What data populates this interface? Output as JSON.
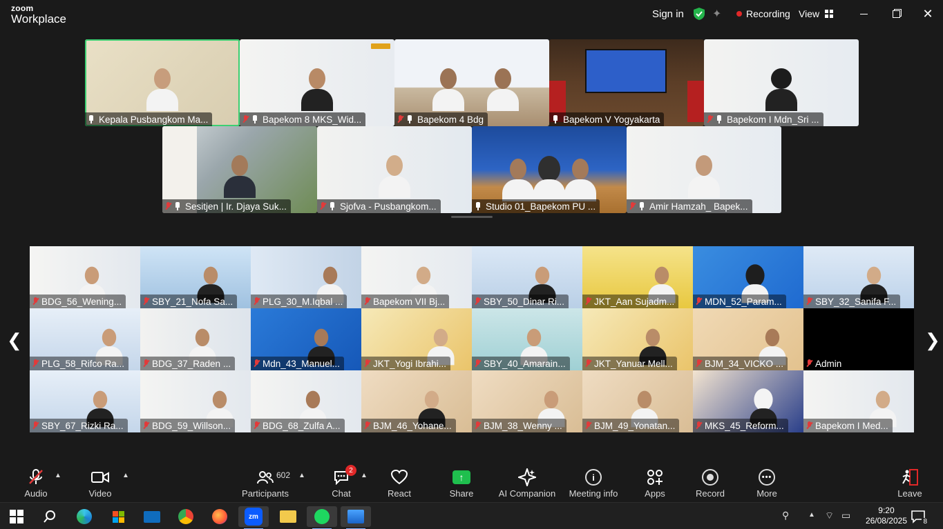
{
  "app": {
    "logo_line1": "zoom",
    "logo_line2": "Workplace"
  },
  "titlebar": {
    "sign_in": "Sign in",
    "recording": "Recording",
    "view": "View"
  },
  "colors": {
    "active_speaker": "#3ccf72",
    "share": "#1fbf4e",
    "recording": "#e02828",
    "muted": "#e23a3a"
  },
  "gallery_top": [
    {
      "name": "Kepala Pusbangkom Ma...",
      "active": true,
      "muted": false
    },
    {
      "name": "Bapekom 8 MKS_Wid...",
      "muted": true
    },
    {
      "name": "Bapekom 4 Bdg",
      "muted": true
    },
    {
      "name": "Bapekom V Yogyakarta",
      "muted": false
    },
    {
      "name": "Bapekom I Mdn_Sri ...",
      "muted": true
    },
    {
      "name": "Sesitjen | Ir. Djaya Suk...",
      "muted": true
    },
    {
      "name": "Sjofva  - Pusbangkom...",
      "muted": true
    },
    {
      "name": "Studio 01_Bapekom PU ...",
      "muted": false
    },
    {
      "name": "Amir Hamzah_ Bapek...",
      "muted": true
    }
  ],
  "gallery_grid": [
    {
      "name": "BDG_56_Wening..."
    },
    {
      "name": "SBY_21_Nofa Sa..."
    },
    {
      "name": "PLG_30_M.Iqbal ..."
    },
    {
      "name": "Bapekom VII Bj..."
    },
    {
      "name": "SBY_50_Dinar Ri..."
    },
    {
      "name": "JKT_Aan Sujadm..."
    },
    {
      "name": "MDN_52_Param..."
    },
    {
      "name": "SBY_32_Sanifa F..."
    },
    {
      "name": "PLG_58_Rifco Ra..."
    },
    {
      "name": "BDG_37_Raden ..."
    },
    {
      "name": "Mdn_43_Manuel..."
    },
    {
      "name": "JKT_Yogi Ibrahi..."
    },
    {
      "name": "SBY_40_Amarain..."
    },
    {
      "name": "JKT_Yanuar Mell..."
    },
    {
      "name": "BJM_34_VICKO ..."
    },
    {
      "name": "Admin"
    },
    {
      "name": "SBY_67_Rizki Ra..."
    },
    {
      "name": "BDG_59_Willson..."
    },
    {
      "name": "BDG_68_Zulfa A..."
    },
    {
      "name": "BJM_46_Yohane..."
    },
    {
      "name": "BJM_38_Wenny ..."
    },
    {
      "name": "BJM_49_Yonatan..."
    },
    {
      "name": "MKS_45_Reform..."
    },
    {
      "name": "Bapekom I Med..."
    }
  ],
  "toolbar": {
    "audio": "Audio",
    "video": "Video",
    "participants": "Participants",
    "participants_count": "602",
    "chat": "Chat",
    "chat_badge": "2",
    "react": "React",
    "share": "Share",
    "ai_companion": "AI Companion",
    "meeting_info": "Meeting info",
    "apps": "Apps",
    "record": "Record",
    "more": "More",
    "leave": "Leave"
  },
  "taskbar": {
    "time": "9:20",
    "date": "26/08/2025",
    "notifications": "8",
    "apps": [
      "start",
      "search",
      "edge",
      "store",
      "mail",
      "chrome",
      "firefox",
      "zoom",
      "explorer",
      "spotify",
      "photos"
    ]
  }
}
